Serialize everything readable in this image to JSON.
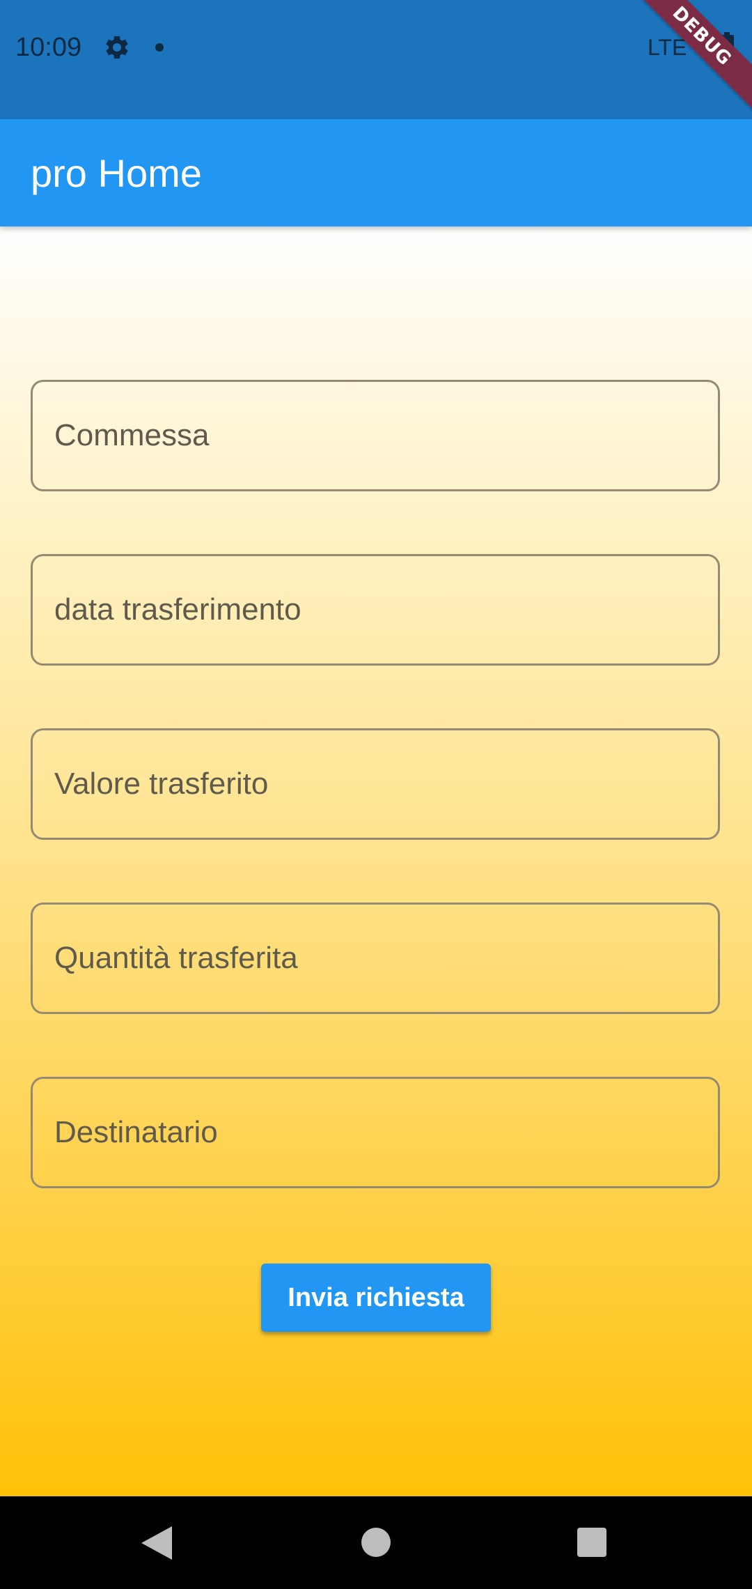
{
  "status_bar": {
    "time": "10:09",
    "network": "LTE",
    "debug_label": "DEBUG",
    "icons": [
      "gear-icon",
      "notification-dot-icon",
      "battery-icon"
    ]
  },
  "app_bar": {
    "title": "pro Home"
  },
  "form": {
    "fields": [
      {
        "placeholder": "Commessa",
        "value": ""
      },
      {
        "placeholder": "data trasferimento",
        "value": ""
      },
      {
        "placeholder": "Valore trasferito",
        "value": ""
      },
      {
        "placeholder": "Quantità trasferita",
        "value": ""
      },
      {
        "placeholder": "Destinatario",
        "value": ""
      }
    ],
    "submit_label": "Invia richiesta"
  },
  "nav_bar": {
    "icons": [
      "back-icon",
      "home-icon",
      "recents-icon"
    ]
  },
  "colors": {
    "status_bar": "#1c74bc",
    "app_bar": "#2196f3",
    "button": "#2196f3",
    "gradient_top": "#ffffff",
    "gradient_bottom": "#ffc107"
  }
}
